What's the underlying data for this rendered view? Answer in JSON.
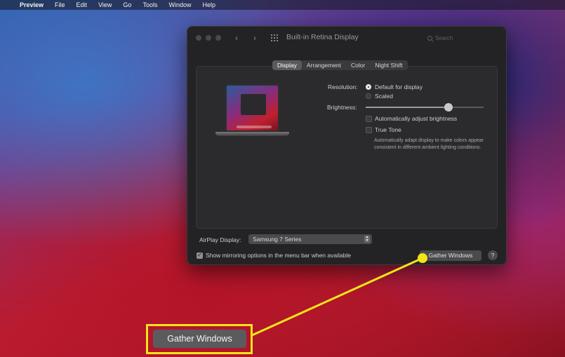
{
  "menubar": {
    "apple": "",
    "items": [
      "Preview",
      "File",
      "Edit",
      "View",
      "Go",
      "Tools",
      "Window",
      "Help"
    ]
  },
  "window": {
    "title": "Built-in Retina Display",
    "search_placeholder": "Search",
    "nav_back": "‹",
    "nav_forward": "›",
    "tabs": [
      "Display",
      "Arrangement",
      "Color",
      "Night Shift"
    ],
    "active_tab": "Display",
    "resolution_label": "Resolution:",
    "resolution_options": [
      "Default for display",
      "Scaled"
    ],
    "resolution_selected": "Default for display",
    "brightness_label": "Brightness:",
    "brightness_level": 0.7,
    "auto_brightness_label": "Automatically adjust brightness",
    "auto_brightness_checked": false,
    "true_tone_label": "True Tone",
    "true_tone_checked": false,
    "true_tone_note": "Automatically adapt display to make colors appear consistent in different ambient lighting conditions.",
    "airplay_label": "AirPlay Display:",
    "airplay_value": "Samsung 7 Series",
    "mirroring_label": "Show mirroring options in the menu bar when available",
    "mirroring_checked": true,
    "gather_windows_label": "Gather Windows",
    "help_label": "?"
  },
  "callout": {
    "label": "Gather Windows",
    "color": "#f2e51a"
  }
}
